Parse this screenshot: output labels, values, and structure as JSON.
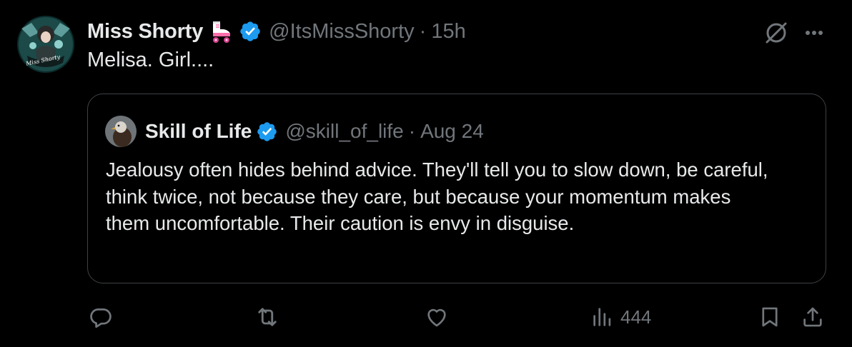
{
  "post": {
    "author": {
      "display_name": "Miss Shorty",
      "handle": "@ItsMissShorty",
      "time": "15h",
      "avatar_text": "Miss Shorty",
      "emoji_icon": "roller-skate-icon",
      "verified_icon": "verified-badge-icon",
      "verified_color": "#1d9bf0"
    },
    "text": "Melisa. Girl....",
    "separator": "·",
    "quote": {
      "author": {
        "display_name": "Skill of Life",
        "handle": "@skill_of_life",
        "date": "Aug 24",
        "verified_icon": "verified-badge-icon"
      },
      "separator": "·",
      "text": "Jealousy often hides behind advice. They'll tell you to slow down, be careful, think twice, not because they care, but because your momentum makes them uncomfortable. Their caution is envy in disguise."
    },
    "actions": {
      "reply_icon": "reply-icon",
      "repost_icon": "repost-icon",
      "like_icon": "heart-icon",
      "views_icon": "views-icon",
      "views_count": "444",
      "bookmark_icon": "bookmark-icon",
      "share_icon": "share-icon"
    },
    "toolbar": {
      "grok_icon": "grok-icon",
      "more_icon": "more-icon"
    },
    "colors": {
      "background": "#000000",
      "primary_text": "#e7e9ea",
      "secondary_text": "#71767b",
      "border": "#3e4144",
      "accent": "#1d9bf0"
    }
  }
}
